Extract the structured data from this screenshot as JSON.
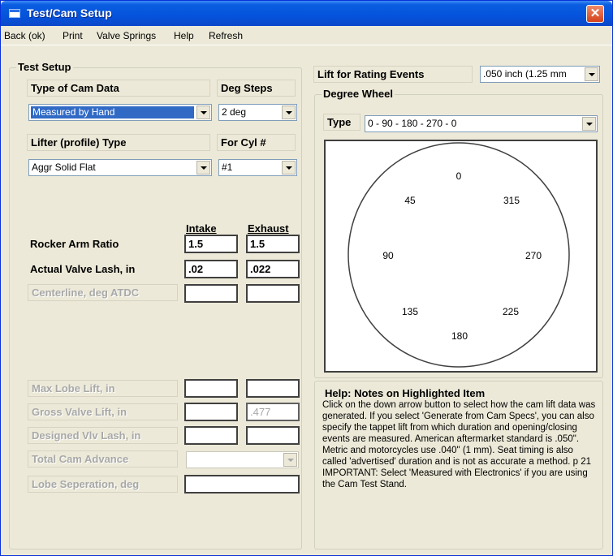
{
  "window": {
    "title": "Test/Cam Setup",
    "close_glyph": "✕"
  },
  "menu": [
    "Back (ok)",
    "Print",
    "Valve Springs",
    "Help",
    "Refresh"
  ],
  "test_setup": {
    "title": "Test Setup",
    "type_of_cam_data_label": "Type of Cam Data",
    "type_of_cam_data_value": "Measured by Hand",
    "deg_steps_label": "Deg Steps",
    "deg_steps_value": "2 deg",
    "lifter_type_label": "Lifter (profile) Type",
    "lifter_type_value": "Aggr Solid Flat",
    "for_cyl_label": "For Cyl #",
    "for_cyl_value": "#1",
    "intake_header": "Intake",
    "exhaust_header": "Exhaust",
    "rocker_arm_ratio_label": "Rocker Arm Ratio",
    "rocker_intake": "1.5",
    "rocker_exhaust": "1.5",
    "valve_lash_label": "Actual Valve Lash, in",
    "lash_intake": ".02",
    "lash_exhaust": ".022",
    "centerline_label": "Centerline, deg ATDC",
    "max_lobe_lift_label": "Max Lobe Lift, in",
    "gross_valve_lift_label": "Gross Valve Lift, in",
    "gross_valve_lift_exhaust": ".477",
    "designed_lash_label": "Designed Vlv Lash, in",
    "total_cam_advance_label": "Total Cam Advance",
    "lobe_separation_label": "Lobe Seperation, deg"
  },
  "lift_rating": {
    "label": "Lift for Rating Events",
    "value": ".050 inch (1.25 mm"
  },
  "degree_wheel": {
    "title": "Degree Wheel",
    "type_label": "Type",
    "type_value": "0 - 90 - 180 - 270 - 0",
    "marks": [
      "0",
      "315",
      "270",
      "225",
      "180",
      "135",
      "90",
      "45"
    ]
  },
  "help": {
    "title": "Help:  Notes on Highlighted Item",
    "text": "Click on the down arrow button to select how the cam lift data was generated.  If you select 'Generate from Cam Specs', you can also specify the tappet lift from which duration and opening/closing events are measured.  American aftermarket standard is .050\". Metric and motorcycles use .040\" (1 mm).  Seat timing is also called 'advertised' duration and is not as accurate a method.  p 21        IMPORTANT:  Select 'Measured with Electronics' if you are using the Cam Test Stand."
  }
}
